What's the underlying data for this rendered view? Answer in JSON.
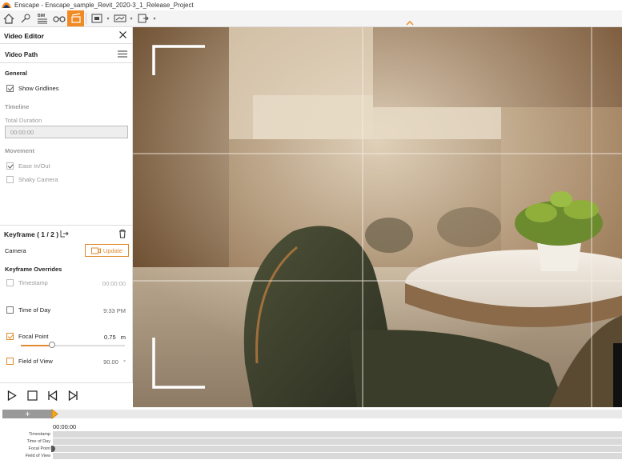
{
  "window": {
    "title": "Enscape - Enscape_sample_Revit_2020-3_1_Release_Project"
  },
  "toolbar": {
    "buttons": [
      {
        "icon": "home-icon"
      },
      {
        "icon": "map-pin-icon"
      },
      {
        "icon": "bim-icon",
        "label": "BIM"
      },
      {
        "icon": "binoculars-icon"
      },
      {
        "icon": "video-editor-icon",
        "active": true
      },
      {
        "icon": "screenshot-icon"
      },
      {
        "icon": "panorama-icon"
      },
      {
        "icon": "export-icon"
      }
    ]
  },
  "panel": {
    "title": "Video Editor",
    "video_path": "Video Path",
    "general": {
      "heading": "General",
      "show_gridlines": "Show Gridlines",
      "show_gridlines_checked": true
    },
    "timeline": {
      "heading": "Timeline",
      "total_duration_label": "Total Duration",
      "total_duration_value": "00:00:00"
    },
    "movement": {
      "heading": "Movement",
      "ease_in_out": "Ease In/Out",
      "ease_checked": true,
      "shaky_camera": "Shaky Camera",
      "shaky_checked": false
    },
    "keyframe": {
      "title": "Keyframe ( 1 / 2 )",
      "camera_label": "Camera",
      "update_label": "Update",
      "overrides_heading": "Keyframe Overrides",
      "timestamp_label": "Timestamp",
      "timestamp_value": "00:00:00",
      "time_of_day_label": "Time of Day",
      "time_of_day_value": "9:33 PM",
      "focal_point_label": "Focal Point",
      "focal_point_value": "0.75",
      "focal_point_unit": "m",
      "focal_point_checked": true,
      "focal_slider_fraction": 0.3,
      "field_of_view_label": "Field of View",
      "field_of_view_value": "90.00",
      "field_of_view_unit": "°"
    }
  },
  "timeline_bar": {
    "add_label": "+",
    "time_label": "00:00:00",
    "tracks": [
      "Timestamp",
      "Time of Day",
      "Focal Point",
      "Field of View"
    ]
  },
  "colors": {
    "accent": "#f08a24",
    "grid": "#ffffff"
  }
}
